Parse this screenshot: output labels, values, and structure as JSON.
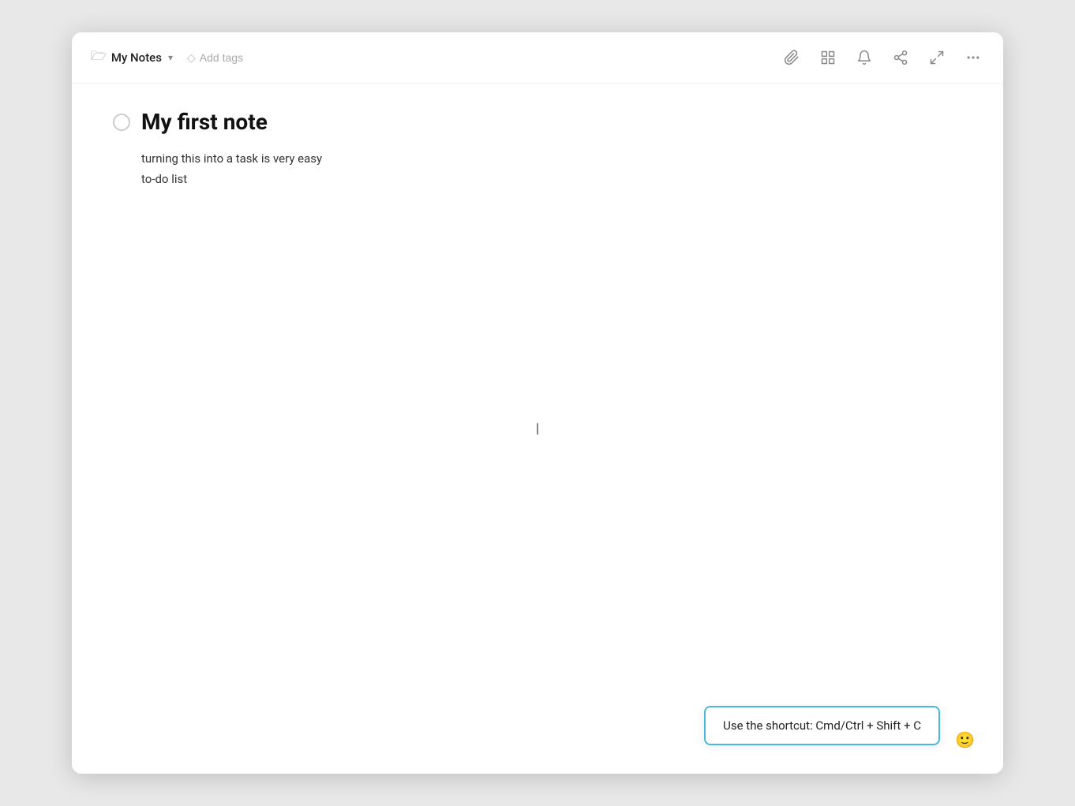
{
  "window": {
    "title": "My Notes"
  },
  "toolbar": {
    "breadcrumb": {
      "title": "My Notes"
    },
    "add_tags_label": "Add tags",
    "icons": {
      "attachment": "📎",
      "grid": "⊞",
      "bell": "🔔",
      "share": "⚇",
      "expand": "⤢",
      "more": "…"
    }
  },
  "note": {
    "title": "My first note",
    "lines": [
      "turning this into a task is very easy",
      "to-do list"
    ]
  },
  "tooltip": {
    "text": "Use the shortcut: Cmd/Ctrl + Shift + C"
  },
  "emoji_btn": "🙂"
}
